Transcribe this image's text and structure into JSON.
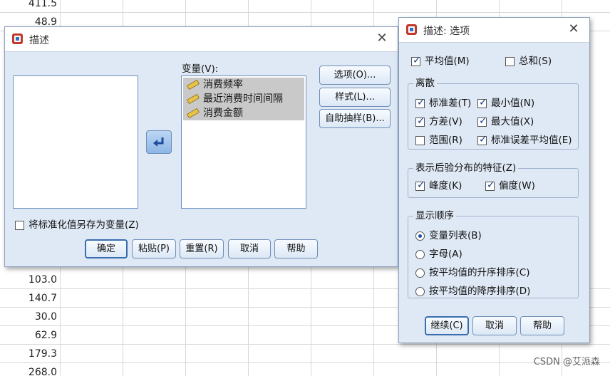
{
  "spreadsheet": {
    "values_top": [
      "411.5",
      "48.9"
    ],
    "values_bottom": [
      "103.0",
      "140.7",
      "30.0",
      "62.9",
      "179.3",
      "268.0"
    ]
  },
  "describe_dialog": {
    "title": "描述",
    "variables_label": "变量(V):",
    "variables": [
      "消费频率",
      "最近消费时间间隔",
      "消费金额"
    ],
    "options_button": "选项(O)...",
    "style_button": "样式(L)...",
    "bootstrap_button": "自助抽样(B)...",
    "save_standardized_label": "将标准化值另存为变量(Z)",
    "save_standardized_checked": false,
    "ok_button": "确定",
    "paste_button": "粘贴(P)",
    "reset_button": "重置(R)",
    "cancel_button": "取消",
    "help_button": "帮助"
  },
  "options_dialog": {
    "title": "描述: 选项",
    "mean": {
      "label": "平均值(M)",
      "checked": true
    },
    "sum": {
      "label": "总和(S)",
      "checked": false
    },
    "dispersion": {
      "title": "离散",
      "std_dev": {
        "label": "标准差(T)",
        "checked": true
      },
      "minimum": {
        "label": "最小值(N)",
        "checked": true
      },
      "variance": {
        "label": "方差(V)",
        "checked": true
      },
      "maximum": {
        "label": "最大值(X)",
        "checked": true
      },
      "range": {
        "label": "范围(R)",
        "checked": false
      },
      "se_mean": {
        "label": "标准误差平均值(E)",
        "checked": true
      }
    },
    "distribution": {
      "title": "表示后验分布的特征(Z)",
      "kurtosis": {
        "label": "峰度(K)",
        "checked": true
      },
      "skewness": {
        "label": "偏度(W)",
        "checked": true
      }
    },
    "display_order": {
      "title": "显示顺序",
      "options": [
        "变量列表(B)",
        "字母(A)",
        "按平均值的升序排序(C)",
        "按平均值的降序排序(D)"
      ],
      "selected_index": 0
    },
    "continue_button": "继续(C)",
    "cancel_button": "取消",
    "help_button": "帮助"
  },
  "icons": {
    "close": "close-icon",
    "app": "spss-app-icon",
    "move_arrow": "move-left-arrow-icon",
    "scale_variable": "ruler-scale-icon"
  },
  "colors": {
    "dialog_bg": "#dfe9f5",
    "button_border": "#6f8fb8",
    "check_mark": "#1b3f8a"
  },
  "watermark": "CSDN @艾派森"
}
